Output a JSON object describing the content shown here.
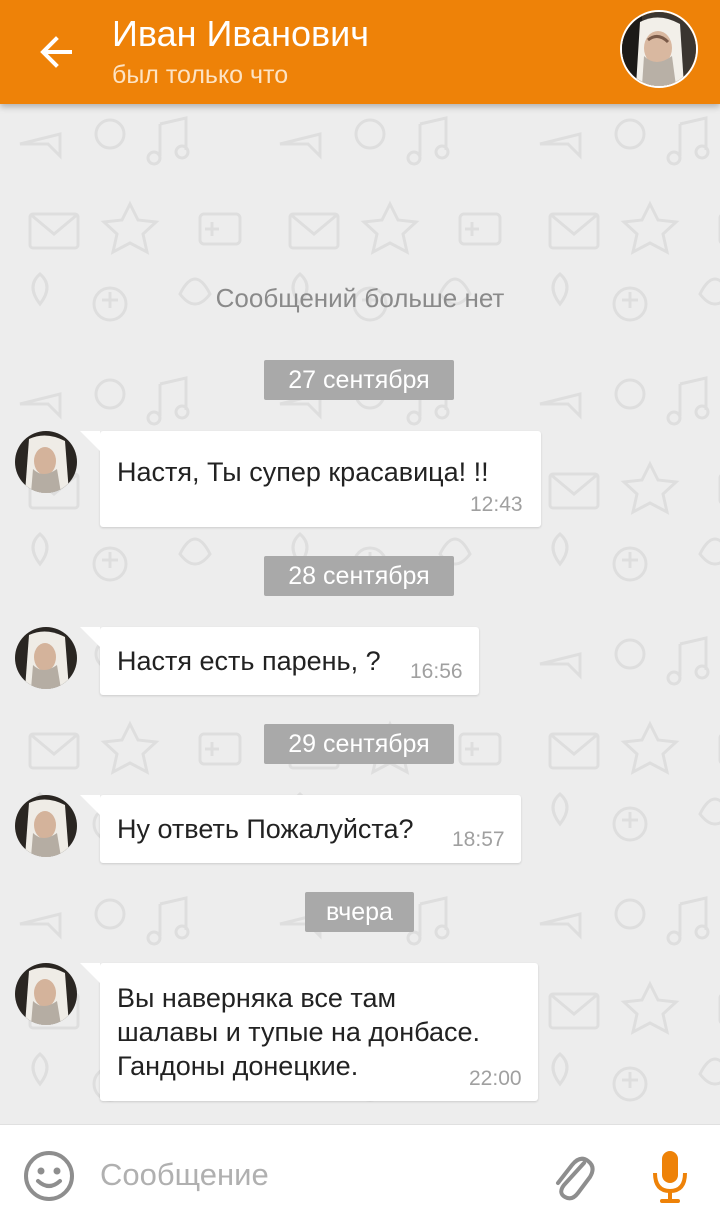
{
  "header": {
    "title": "Иван Иванович",
    "subtitle": "был только что",
    "back_icon": "arrow-left-icon",
    "avatar_icon": "contact-avatar"
  },
  "chat": {
    "no_more_label": "Сообщений больше нет",
    "sections": [
      {
        "date": "27 сентября",
        "messages": [
          {
            "text": "Настя, Ты супер красавица! !!",
            "time": "12:43"
          }
        ]
      },
      {
        "date": "28 сентября",
        "messages": [
          {
            "text": "Настя есть парень, ?",
            "time": "16:56"
          }
        ]
      },
      {
        "date": "29 сентября",
        "messages": [
          {
            "text": "Ну ответь Пожалуйста?",
            "time": "18:57"
          }
        ]
      },
      {
        "date": "вчера",
        "messages": [
          {
            "text_lines": [
              "Вы наверняка все там",
              "шалавы и тупые на донбасе.",
              "Гандоны донецкие."
            ],
            "time": "22:00"
          }
        ]
      }
    ]
  },
  "composer": {
    "placeholder": "Сообщение",
    "value": "",
    "icons": [
      "smile-icon",
      "paperclip-icon",
      "microphone-icon"
    ]
  },
  "colors": {
    "header": "#ee8208",
    "date_chip": "#a9a9a9",
    "background": "#ededed",
    "accent": "#ee8208"
  }
}
